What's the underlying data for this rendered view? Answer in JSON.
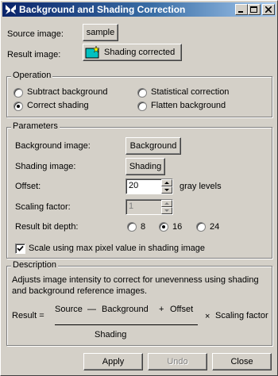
{
  "window": {
    "title": "Background and Shading Correction",
    "minimize_glyph": "_",
    "maximize_glyph": "□",
    "close_glyph": "×"
  },
  "source": {
    "label": "Source image:",
    "button": "sample"
  },
  "result": {
    "label": "Result image:",
    "button": "Shading corrected"
  },
  "operation": {
    "title": "Operation",
    "options": [
      {
        "label": "Subtract background",
        "selected": false
      },
      {
        "label": "Correct shading",
        "selected": true
      },
      {
        "label": "Statistical correction",
        "selected": false
      },
      {
        "label": "Flatten background",
        "selected": false
      }
    ]
  },
  "parameters": {
    "title": "Parameters",
    "background_label": "Background image:",
    "background_button": "Background",
    "shading_label": "Shading image:",
    "shading_button": "Shading",
    "offset_label": "Offset:",
    "offset_value": "20",
    "offset_unit": "gray levels",
    "scaling_label": "Scaling factor:",
    "scaling_value": "1",
    "bitdepth_label": "Result bit depth:",
    "bitdepth_options": [
      {
        "label": "8",
        "selected": false
      },
      {
        "label": "16",
        "selected": true
      },
      {
        "label": "24",
        "selected": false
      }
    ],
    "scale_checkbox_label": "Scale using max pixel value in shading image",
    "scale_checked": true
  },
  "description": {
    "title": "Description",
    "text": "Adjusts image intensity to correct for unevenness using shading and background reference images.",
    "formula": {
      "result": "Result =",
      "source": "Source",
      "minus": "—",
      "background": "Background",
      "plus": "+",
      "offset": "Offset",
      "denominator": "Shading",
      "times": "×",
      "scaling": "Scaling factor"
    }
  },
  "footer": {
    "apply": "Apply",
    "undo": "Undo",
    "close": "Close"
  },
  "colors": {
    "titlebar_start": "#0a246a",
    "titlebar_end": "#a6caf0",
    "face": "#d4d0c8"
  }
}
